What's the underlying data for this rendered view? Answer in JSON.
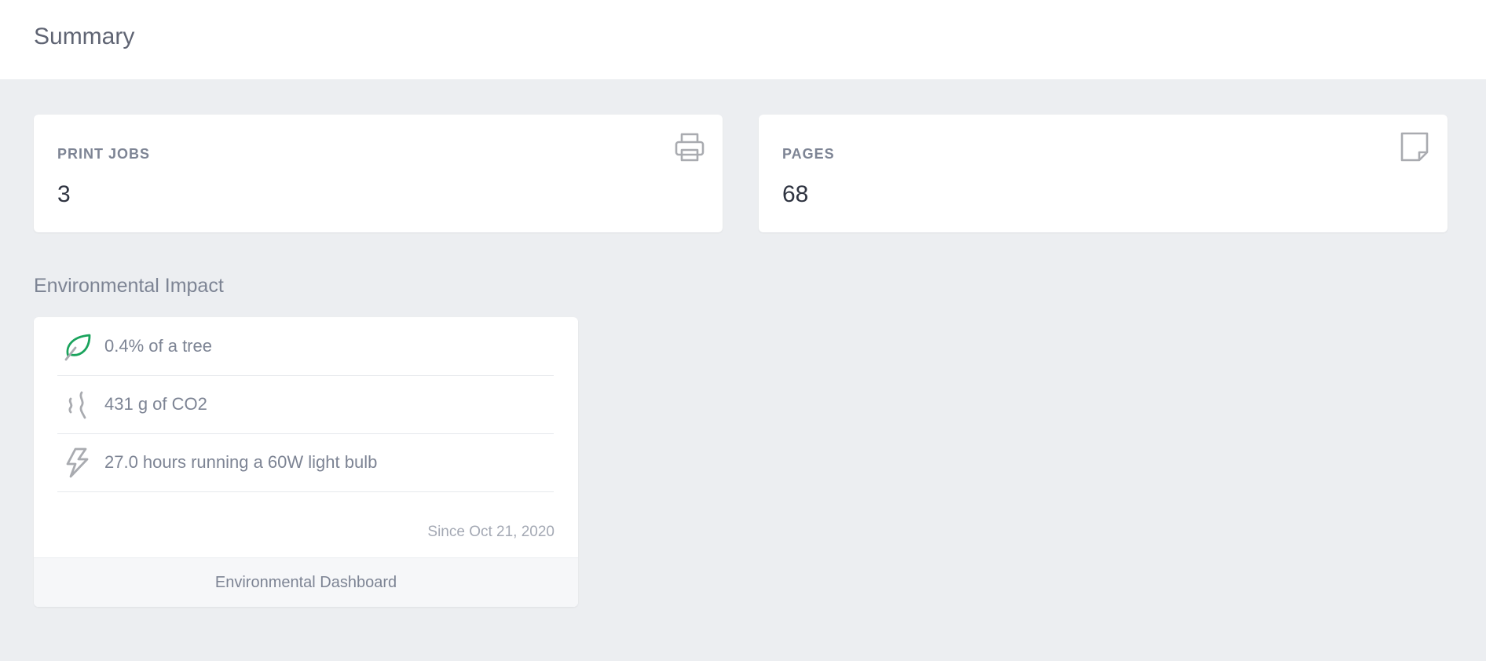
{
  "header": {
    "title": "Summary"
  },
  "stats": {
    "print_jobs": {
      "label": "PRINT JOBS",
      "value": "3",
      "icon": "printer-icon"
    },
    "pages": {
      "label": "PAGES",
      "value": "68",
      "icon": "page-icon"
    }
  },
  "environment": {
    "title": "Environmental Impact",
    "rows": [
      {
        "text": "0.4% of a tree",
        "icon": "leaf-icon",
        "icon_color": "#1aa35c"
      },
      {
        "text": "431 g of CO2",
        "icon": "smoke-icon",
        "icon_color": "#a9abb0"
      },
      {
        "text": "27.0 hours running a 60W light bulb",
        "icon": "lightning-icon",
        "icon_color": "#a9abb0"
      }
    ],
    "since": "Since Oct 21, 2020",
    "footer_link": "Environmental Dashboard"
  },
  "colors": {
    "background": "#eceef1",
    "card": "#ffffff",
    "accent_green": "#1aa35c",
    "icon_gray": "#a9abb0"
  }
}
